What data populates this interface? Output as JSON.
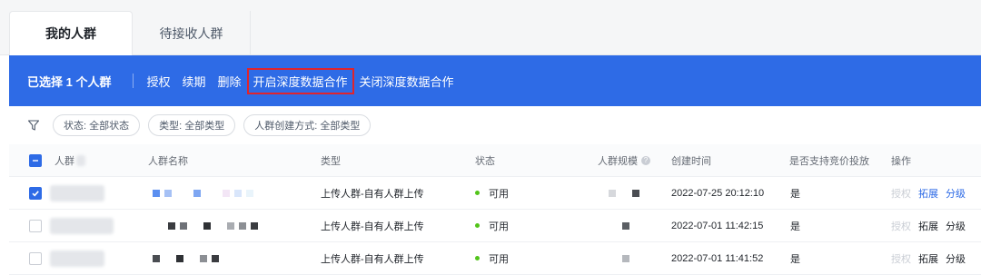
{
  "tabs": [
    {
      "label": "我的人群",
      "active": true
    },
    {
      "label": "待接收人群",
      "active": false
    }
  ],
  "action_bar": {
    "selected_text": "已选择 1 个人群",
    "actions": [
      {
        "label": "授权",
        "highlighted": false
      },
      {
        "label": "续期",
        "highlighted": false
      },
      {
        "label": "删除",
        "highlighted": false
      },
      {
        "label": "开启深度数据合作",
        "highlighted": true
      },
      {
        "label": "关闭深度数据合作",
        "highlighted": false
      }
    ],
    "bar_color": "#2e6be6",
    "highlight_color": "#e0242c"
  },
  "filters": {
    "icon": "filter-icon",
    "chips": [
      {
        "label": "状态: 全部状态"
      },
      {
        "label": "类型: 全部类型"
      },
      {
        "label": "人群创建方式: 全部类型"
      }
    ]
  },
  "table": {
    "columns": {
      "id": "人群",
      "name": "人群名称",
      "type": "类型",
      "status": "状态",
      "scale": "人群规模",
      "created": "创建时间",
      "bidding": "是否支持竞价投放",
      "ops": "操作"
    },
    "rows": [
      {
        "checked": true,
        "type": "上传人群-自有人群上传",
        "status": "可用",
        "created": "2022-07-25 20:12:10",
        "bidding": "是",
        "ops": [
          {
            "label": "授权",
            "style": "disabled"
          },
          {
            "label": "拓展",
            "style": "link"
          },
          {
            "label": "分级",
            "style": "link"
          }
        ]
      },
      {
        "checked": false,
        "type": "上传人群-自有人群上传",
        "status": "可用",
        "created": "2022-07-01 11:42:15",
        "bidding": "是",
        "ops": [
          {
            "label": "授权",
            "style": "disabled"
          },
          {
            "label": "拓展",
            "style": "dark"
          },
          {
            "label": "分级",
            "style": "dark"
          }
        ]
      },
      {
        "checked": false,
        "type": "上传人群-自有人群上传",
        "status": "可用",
        "created": "2022-07-01 11:41:52",
        "bidding": "是",
        "ops": [
          {
            "label": "授权",
            "style": "disabled"
          },
          {
            "label": "拓展",
            "style": "dark"
          },
          {
            "label": "分级",
            "style": "dark"
          }
        ]
      }
    ],
    "status_color": "#52c41a"
  }
}
